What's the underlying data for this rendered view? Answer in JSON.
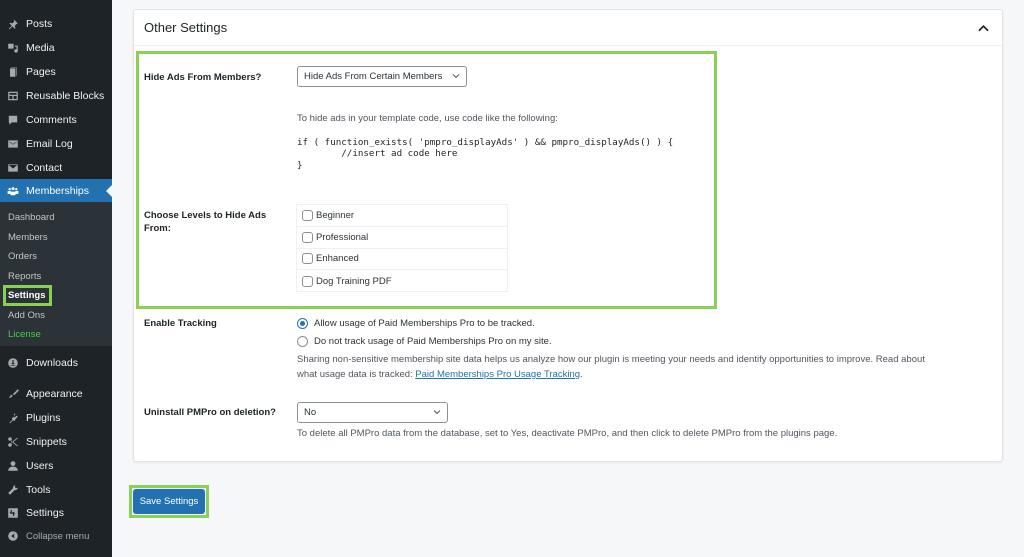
{
  "sidebar": {
    "items": [
      {
        "label": "Posts",
        "icon": "pin-icon"
      },
      {
        "label": "Media",
        "icon": "media-icon"
      },
      {
        "label": "Pages",
        "icon": "pages-icon"
      },
      {
        "label": "Reusable Blocks",
        "icon": "blocks-icon"
      },
      {
        "label": "Comments",
        "icon": "comment-icon"
      },
      {
        "label": "Email Log",
        "icon": "email-icon"
      },
      {
        "label": "Contact",
        "icon": "envelope-icon"
      },
      {
        "label": "Memberships",
        "icon": "groups-icon",
        "active": true
      }
    ],
    "submenu": [
      {
        "label": "Dashboard"
      },
      {
        "label": "Members"
      },
      {
        "label": "Orders"
      },
      {
        "label": "Reports"
      },
      {
        "label": "Settings",
        "current": true
      },
      {
        "label": "Add Ons"
      },
      {
        "label": "License"
      }
    ],
    "items_after": [
      {
        "label": "Downloads",
        "icon": "download-icon"
      },
      {
        "label": "Appearance",
        "icon": "brush-icon"
      },
      {
        "label": "Plugins",
        "icon": "plugin-icon"
      },
      {
        "label": "Snippets",
        "icon": "scissors-icon"
      },
      {
        "label": "Users",
        "icon": "user-icon"
      },
      {
        "label": "Tools",
        "icon": "wrench-icon"
      },
      {
        "label": "Settings",
        "icon": "settings-icon"
      }
    ],
    "collapse_label": "Collapse menu"
  },
  "panel": {
    "title": "Other Settings",
    "hide_ads": {
      "label": "Hide Ads From Members?",
      "selected": "Hide Ads From Certain Members",
      "help": "To hide ads in your template code, use code like the following:",
      "code_line1": "if ( function_exists( 'pmpro_displayAds' ) && pmpro_displayAds() ) {",
      "code_line2": "        //insert ad code here",
      "code_line3": "}"
    },
    "levels": {
      "label": "Choose Levels to Hide Ads From:",
      "options": [
        {
          "label": "Beginner",
          "checked": false
        },
        {
          "label": "Professional",
          "checked": false
        },
        {
          "label": "Enhanced",
          "checked": false
        },
        {
          "label": "Dog Training PDF",
          "checked": false
        }
      ]
    },
    "tracking": {
      "label": "Enable Tracking",
      "option_allow": "Allow usage of Paid Memberships Pro to be tracked.",
      "option_deny": "Do not track usage of Paid Memberships Pro on my site.",
      "selected": "allow",
      "desc_line1": "Sharing non-sensitive membership site data helps us analyze how our plugin is meeting your needs and identify opportunities to improve. Read about",
      "desc_line2_prefix": "what usage data is tracked: ",
      "desc_link": "Paid Memberships Pro Usage Tracking",
      "desc_line2_suffix": "."
    },
    "uninstall": {
      "label": "Uninstall PMPro on deletion?",
      "selected": "No",
      "help": "To delete all PMPro data from the database, set to Yes, deactivate PMPro, and then click to delete PMPro from the plugins page."
    }
  },
  "save_button": "Save Settings",
  "colors": {
    "sidebar_bg": "#1d2327",
    "accent": "#2271b1",
    "highlight": "#8bd056",
    "license": "#3fd23f"
  }
}
